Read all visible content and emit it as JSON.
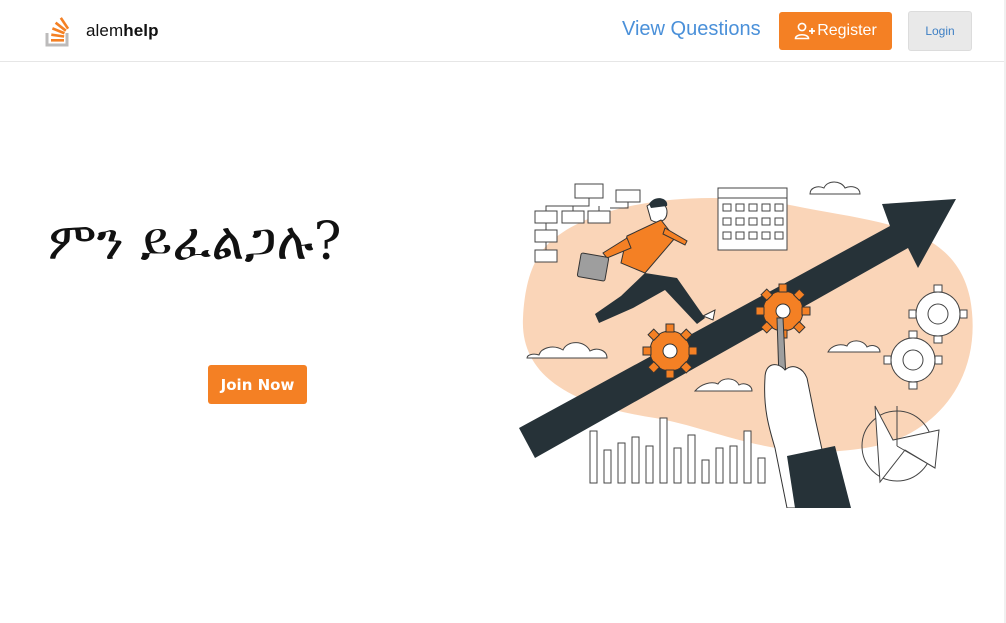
{
  "nav": {
    "brand_light": "alem",
    "brand_bold": "help",
    "view_questions": "View Questions",
    "register": "Register",
    "login": "Login"
  },
  "hero": {
    "headline": "ምን ይፈልጋሉ?",
    "join_button": "Join Now"
  },
  "colors": {
    "accent": "#f48024",
    "link": "#4a90d9",
    "blob": "#fad5b8",
    "arrow": "#263238"
  }
}
